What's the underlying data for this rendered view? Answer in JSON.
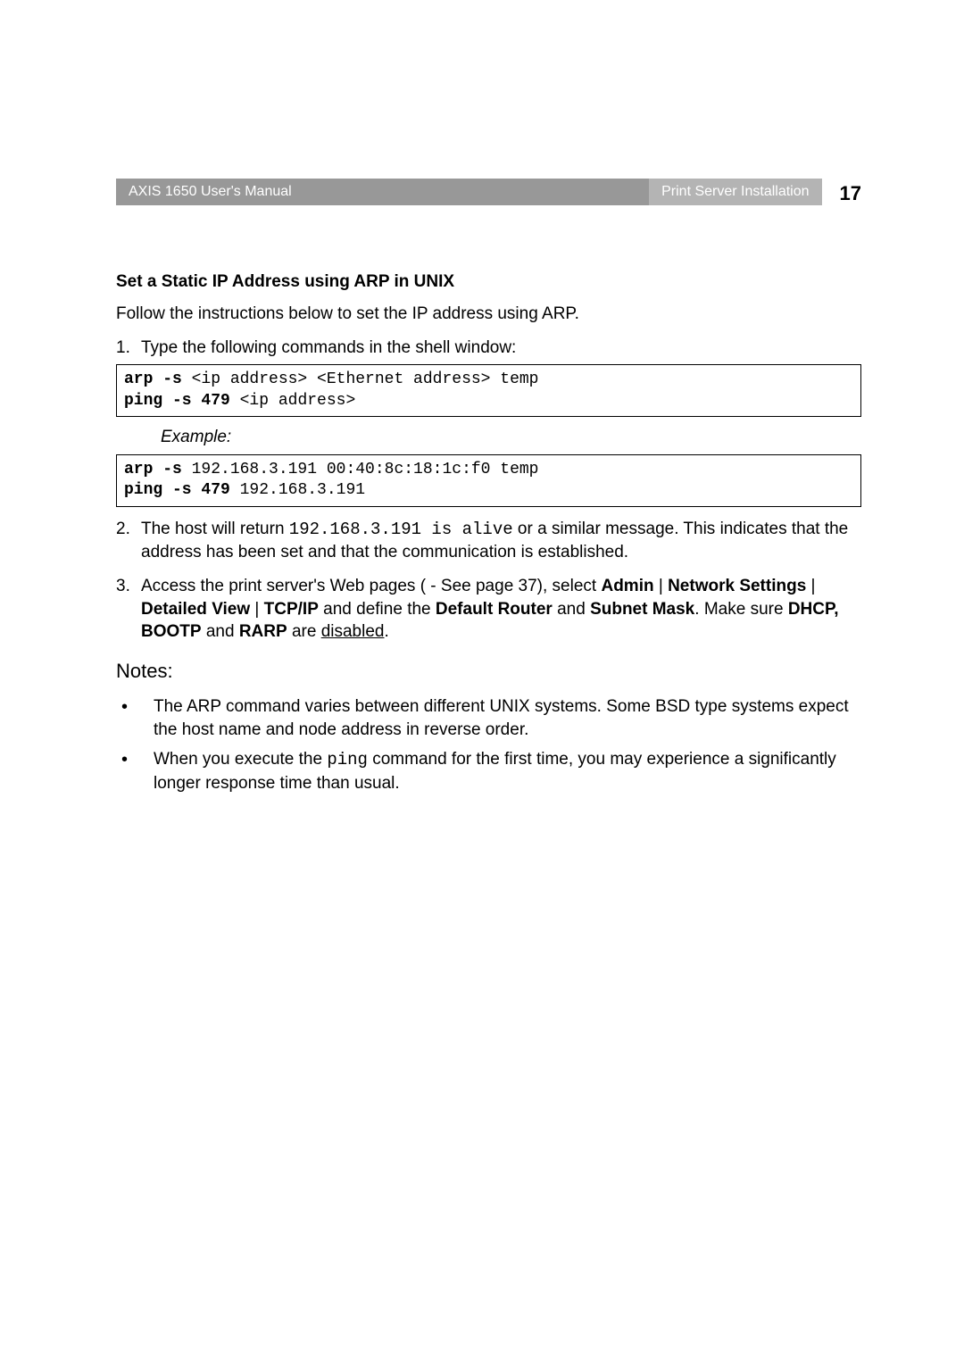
{
  "header": {
    "left": "AXIS 1650 User's Manual",
    "right": "Print Server Installation",
    "page": "17"
  },
  "section": {
    "title": "Set a Static IP Address using ARP in UNIX",
    "intro": "Follow the instructions below to set the IP address using ARP."
  },
  "step1": {
    "num": "1.",
    "text": "Type the following commands in the shell window:",
    "code_bold1": "arp -s",
    "code_plain1": " <ip address> <Ethernet address> temp",
    "code_bold2": "ping -s 479",
    "code_plain2": " <ip address>"
  },
  "example": {
    "label": "Example:",
    "code_bold1": "arp -s",
    "code_plain1": " 192.168.3.191 00:40:8c:18:1c:f0 temp",
    "code_bold2": "ping -s 479",
    "code_plain2": " 192.168.3.191"
  },
  "step2": {
    "num": "2.",
    "pre": "The host will return ",
    "code": "192.168.3.191 is alive",
    "post": " or a similar message. This indicates that the address has been set and that the communication is established."
  },
  "step3": {
    "num": "3.",
    "t1": "Access the print server's Web pages ( - See page 37), select ",
    "b1": "Admin",
    "t2": " | ",
    "b2": "Network Settings",
    "t3": " | ",
    "b3": "Detailed View",
    "t4": " | ",
    "b4": "TCP/IP",
    "t5": " and define the ",
    "b5": "Default Router",
    "t6": " and ",
    "b6": "Subnet Mask",
    "t7": ". Make sure ",
    "b7": "DHCP, BOOTP",
    "t8": " and ",
    "b8": "RARP",
    "t9": " are ",
    "u1": "disabled",
    "t10": "."
  },
  "notes": {
    "title": "Notes:",
    "bullet1": "The ARP command varies between different UNIX systems. Some BSD type systems expect the host name and node address in reverse order.",
    "bullet2_pre": "When you execute the ",
    "bullet2_code": "ping",
    "bullet2_post": " command for the first time, you may experience a significantly longer response time than usual."
  }
}
